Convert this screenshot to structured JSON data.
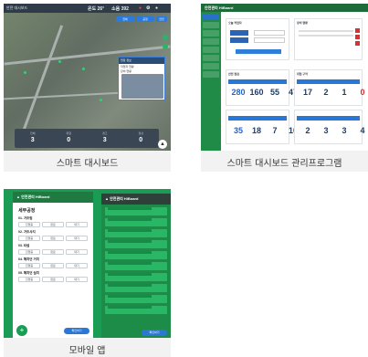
{
  "cards": [
    {
      "caption": "스마트 대시보드",
      "map_top_left": "안전 대시보드",
      "top_right": {
        "temp_label": "온도",
        "temp_value": "26°",
        "noise_label": "소음",
        "noise_value": "392"
      },
      "tabs": [
        "전체",
        "공정",
        "안전"
      ],
      "popup_title": "현장 정보",
      "popup_lines": [
        "작업자 현황",
        "장비 현황",
        "CCTV"
      ],
      "stats": [
        {
          "label": "전체",
          "value": "3"
        },
        {
          "label": "위험",
          "value": "0"
        },
        {
          "label": "경고",
          "value": "3"
        },
        {
          "label": "정상",
          "value": "0"
        }
      ]
    },
    {
      "caption": "스마트 대시보드 관리프로그램",
      "brand": "안전관리 HiBoard",
      "panel_titles": [
        "오늘 작업자",
        "장비 현황",
        "안전 점검",
        "위험 구역"
      ],
      "row1": [
        "280",
        "160",
        "55",
        "47"
      ],
      "row1b": [
        "17",
        "2",
        "1",
        "0"
      ],
      "row2": [
        "35",
        "18",
        "7",
        "10"
      ],
      "row2b": [
        "2",
        "3",
        "3",
        "4"
      ]
    },
    {
      "caption": "모바일 앱",
      "brand": "안전관리 HiBoard",
      "page_title": "세부공정",
      "sections": [
        "01. 가조립",
        "02. 가조사지",
        "03. 타설",
        "04. 해치던 거치",
        "05. 해치던 설치"
      ],
      "cell_labels": [
        "진행중",
        "완료",
        "대기"
      ],
      "submit_label": "확인하기"
    }
  ]
}
